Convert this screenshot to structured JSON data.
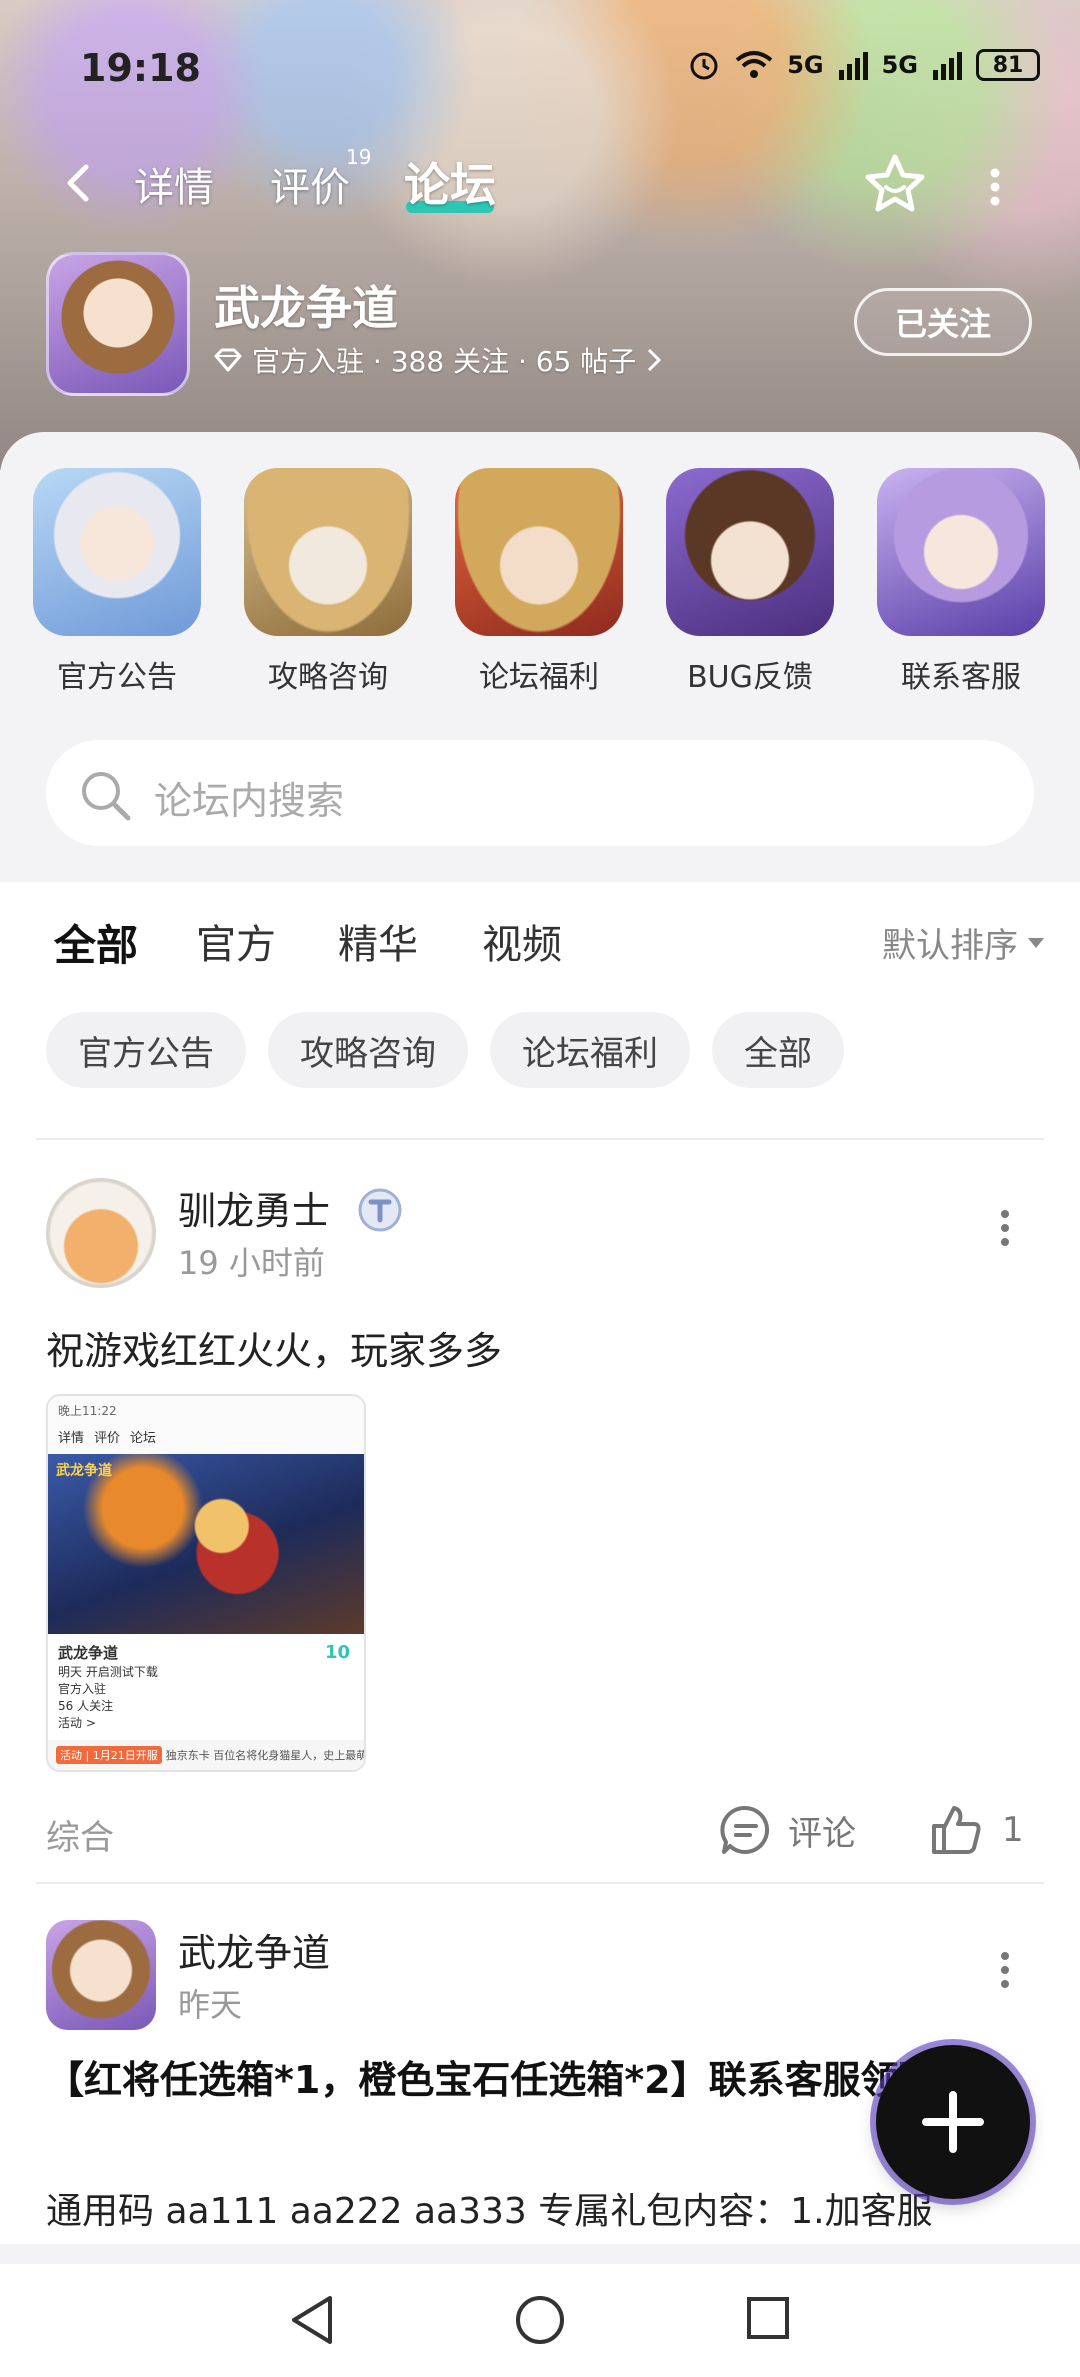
{
  "status_bar": {
    "time": "19:18",
    "signal1": "5G",
    "signal2": "5G",
    "battery": "81"
  },
  "header": {
    "tabs": [
      "详情",
      "评价",
      "论坛"
    ],
    "active_tab": "论坛",
    "review_count": "19"
  },
  "game": {
    "title": "武龙争道",
    "meta": "官方入驻 · 388 关注 · 65 帖子",
    "follow_label": "已关注"
  },
  "quick_links": [
    {
      "label": "官方公告"
    },
    {
      "label": "攻略咨询"
    },
    {
      "label": "论坛福利"
    },
    {
      "label": "BUG反馈"
    },
    {
      "label": "联系客服"
    }
  ],
  "search": {
    "placeholder": "论坛内搜索"
  },
  "filter_tabs": [
    "全部",
    "官方",
    "精华",
    "视频"
  ],
  "sort_label": "默认排序",
  "chips": [
    "官方公告",
    "攻略咨询",
    "论坛福利",
    "全部"
  ],
  "posts": [
    {
      "author": "驯龙勇士",
      "time": "19 小时前",
      "text": "祝游戏红红火火，玩家多多",
      "screenshot": {
        "status_time": "晚上11:22",
        "tabs": [
          "详情",
          "评价",
          "论坛"
        ],
        "art_title": "武龙争道",
        "game_name": "武龙争道",
        "line1": "明天 开启测试下载",
        "line2": "官方入驻",
        "line3": "56 人关注",
        "line4": "活动 >",
        "score": "10",
        "tag": "活动 | 1月21日开服",
        "bottom_text": "独京东卡 百位名将化身猫星人，史上最萌乱"
      },
      "category": "综合",
      "comment_label": "评论",
      "likes": "1"
    },
    {
      "author": "武龙争道",
      "time": "昨天",
      "title": "【红将任选箱*1，橙色宝石任选箱*2】联系客服领取！",
      "body": "通用码 aa111 aa222 aa333 专属礼包内容：1.加客服"
    }
  ],
  "colors": {
    "accent": "#2ec7b6",
    "fab": "#111111"
  }
}
